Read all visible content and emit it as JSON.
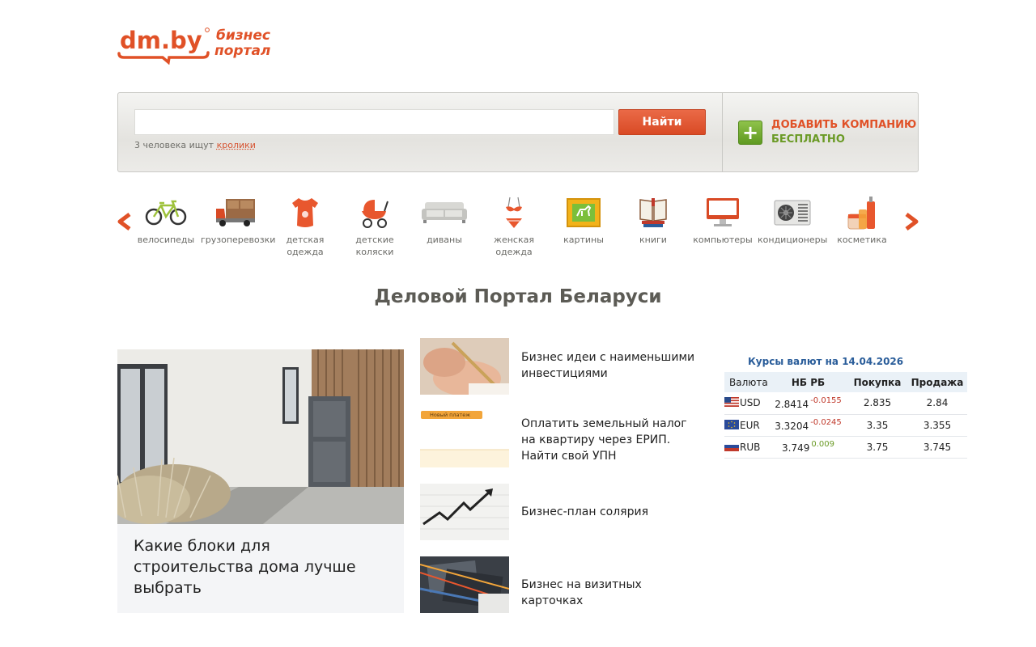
{
  "logo": {
    "main": "dm.by",
    "sub_line1": "бизнес",
    "sub_line2": "портал"
  },
  "search": {
    "placeholder": "",
    "value": "",
    "button_label": "Найти",
    "hint_prefix": "3 человека ищут",
    "hint_link": "кролики"
  },
  "add_company": {
    "line1": "ДОБАВИТЬ КОМПАНИЮ",
    "line2": "БЕСПЛАТНО"
  },
  "categories": [
    {
      "label": "велосипеды",
      "icon": "bicycle-icon"
    },
    {
      "label": "грузоперевозки",
      "icon": "truck-icon"
    },
    {
      "label": "детская одежда",
      "icon": "baby-clothes-icon"
    },
    {
      "label": "детские коляски",
      "icon": "stroller-icon"
    },
    {
      "label": "диваны",
      "icon": "sofa-icon"
    },
    {
      "label": "женская одежда",
      "icon": "swimsuit-icon"
    },
    {
      "label": "картины",
      "icon": "picture-icon"
    },
    {
      "label": "книги",
      "icon": "books-icon"
    },
    {
      "label": "компьютеры",
      "icon": "computer-icon"
    },
    {
      "label": "кондиционеры",
      "icon": "air-conditioner-icon"
    },
    {
      "label": "косметика",
      "icon": "cosmetics-icon"
    }
  ],
  "page_title": "Деловой Портал Беларуси",
  "feature": {
    "title": "Какие блоки для строительства дома лучше выбрать"
  },
  "news": [
    {
      "title": "Бизнес идеи с наименьшими инвестициями"
    },
    {
      "title": "Оплатить земельный налог на квартиру через ЕРИП. Найти свой УПН",
      "thumb_caption": "Новый платеж"
    },
    {
      "title": "Бизнес-план солярия"
    },
    {
      "title": "Бизнес на визитных карточках"
    }
  ],
  "currency": {
    "title": "Курсы валют на 14.04.2026",
    "headers": [
      "Валюта",
      "НБ РБ",
      "Покупка",
      "Продажа"
    ],
    "rows": [
      {
        "code": "USD",
        "nb": "2.8414",
        "delta": "-0.0155",
        "buy": "2.835",
        "sell": "2.84"
      },
      {
        "code": "EUR",
        "nb": "3.3204",
        "delta": "-0.0245",
        "buy": "3.35",
        "sell": "3.355"
      },
      {
        "code": "RUB",
        "nb": "3.749",
        "delta": "0.009",
        "buy": "3.75",
        "sell": "3.745"
      }
    ]
  },
  "colors": {
    "accent": "#e05127",
    "green": "#6a9a25",
    "link_blue": "#2a5d9a",
    "title_gray": "#5c5b55"
  }
}
